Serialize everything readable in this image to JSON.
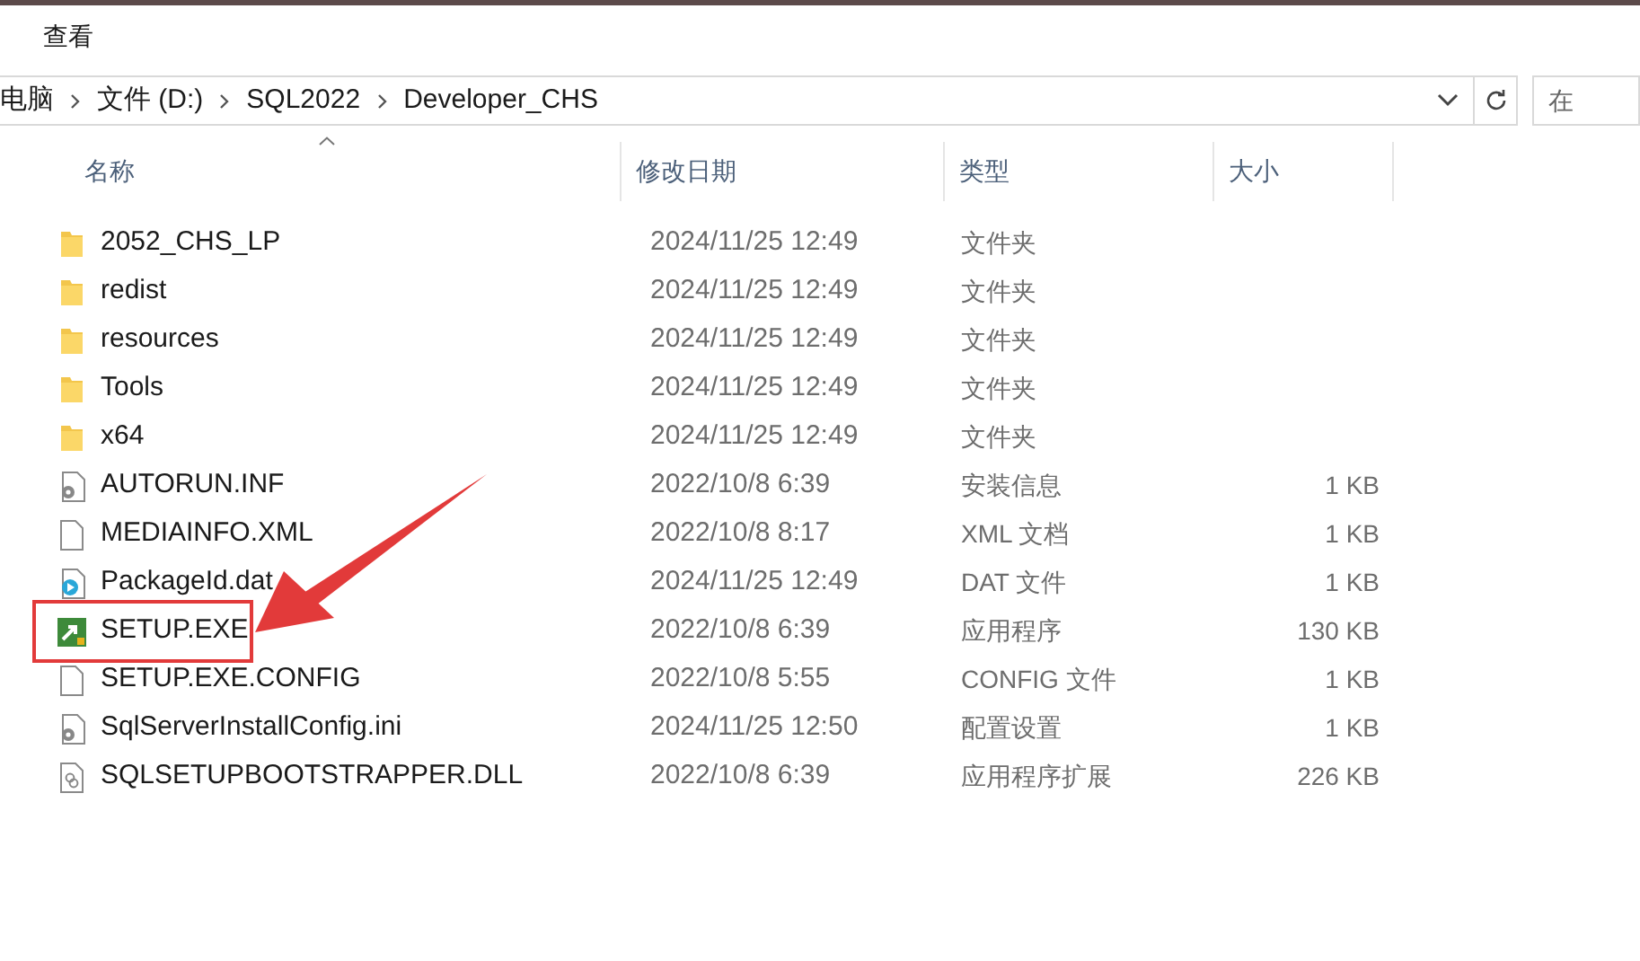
{
  "menu": [
    {
      "label": "查看"
    }
  ],
  "address": {
    "crumbs": [
      "电脑",
      "文件 (D:)",
      "SQL2022",
      "Developer_CHS"
    ]
  },
  "search": {
    "placeholder": "在"
  },
  "columns": [
    {
      "label": "名称",
      "sorted": true
    },
    {
      "label": "修改日期",
      "sorted": false
    },
    {
      "label": "类型",
      "sorted": false
    },
    {
      "label": "大小",
      "sorted": false
    }
  ],
  "rows": [
    {
      "name": "2052_CHS_LP",
      "date": "2024/11/25 12:49",
      "type": "文件夹",
      "size": "",
      "kind": "folder",
      "highlighted": false
    },
    {
      "name": "redist",
      "date": "2024/11/25 12:49",
      "type": "文件夹",
      "size": "",
      "kind": "folder",
      "highlighted": false
    },
    {
      "name": "resources",
      "date": "2024/11/25 12:49",
      "type": "文件夹",
      "size": "",
      "kind": "folder",
      "highlighted": false
    },
    {
      "name": "Tools",
      "date": "2024/11/25 12:49",
      "type": "文件夹",
      "size": "",
      "kind": "folder",
      "highlighted": false
    },
    {
      "name": "x64",
      "date": "2024/11/25 12:49",
      "type": "文件夹",
      "size": "",
      "kind": "folder",
      "highlighted": false
    },
    {
      "name": "AUTORUN.INF",
      "date": "2022/10/8 6:39",
      "type": "安装信息",
      "size": "1 KB",
      "kind": "settings",
      "highlighted": false
    },
    {
      "name": "MEDIAINFO.XML",
      "date": "2022/10/8 8:17",
      "type": "XML 文档",
      "size": "1 KB",
      "kind": "blank",
      "highlighted": false
    },
    {
      "name": "PackageId.dat",
      "date": "2024/11/25 12:49",
      "type": "DAT 文件",
      "size": "1 KB",
      "kind": "media",
      "highlighted": false
    },
    {
      "name": "SETUP.EXE",
      "date": "2022/10/8 6:39",
      "type": "应用程序",
      "size": "130 KB",
      "kind": "exe",
      "highlighted": true
    },
    {
      "name": "SETUP.EXE.CONFIG",
      "date": "2022/10/8 5:55",
      "type": "CONFIG 文件",
      "size": "1 KB",
      "kind": "blank",
      "highlighted": false
    },
    {
      "name": "SqlServerInstallConfig.ini",
      "date": "2024/11/25 12:50",
      "type": "配置设置",
      "size": "1 KB",
      "kind": "settings",
      "highlighted": false
    },
    {
      "name": "SQLSETUPBOOTSTRAPPER.DLL",
      "date": "2022/10/8 6:39",
      "type": "应用程序扩展",
      "size": "226 KB",
      "kind": "dll",
      "highlighted": false
    }
  ]
}
